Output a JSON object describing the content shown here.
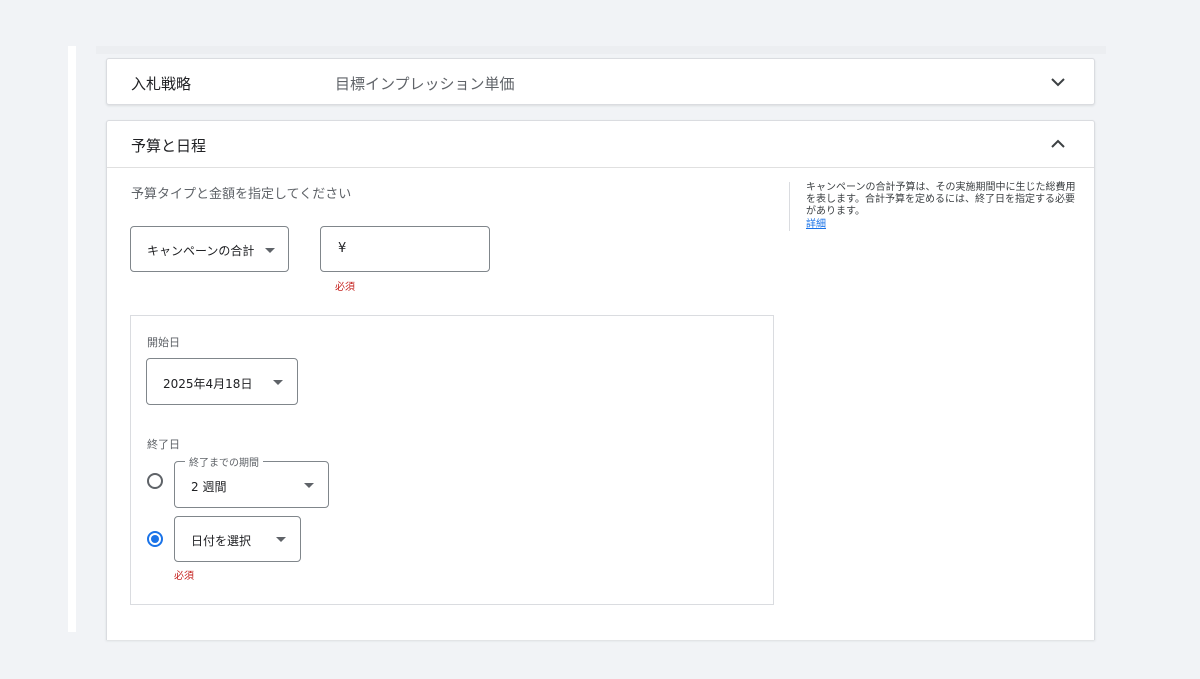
{
  "bidding": {
    "title": "入札戦略",
    "summary": "目標インプレッション単価"
  },
  "budget": {
    "title": "予算と日程",
    "instruction": "予算タイプと金額を指定してください",
    "budget_type_value": "キャンペーンの合計",
    "amount_prefix": "¥",
    "amount_required": "必須",
    "help_text": "キャンペーンの合計予算は、その実施期間中に生じた総費用を表します。合計予算を定めるには、終了日を指定する必要があります。",
    "help_link": "詳細",
    "start_date_label": "開始日",
    "start_date_value": "2025年4月18日",
    "end_date_label": "終了日",
    "period_label": "終了までの期間",
    "period_value": "2 週間",
    "pick_date_value": "日付を選択",
    "end_required": "必須"
  },
  "icons": {
    "bidding_chevron": "chevron-down-icon",
    "budget_chevron": "chevron-up-icon"
  },
  "colors": {
    "accent": "#1a73e8",
    "error": "#c5221f",
    "background": "#f1f3f6"
  }
}
